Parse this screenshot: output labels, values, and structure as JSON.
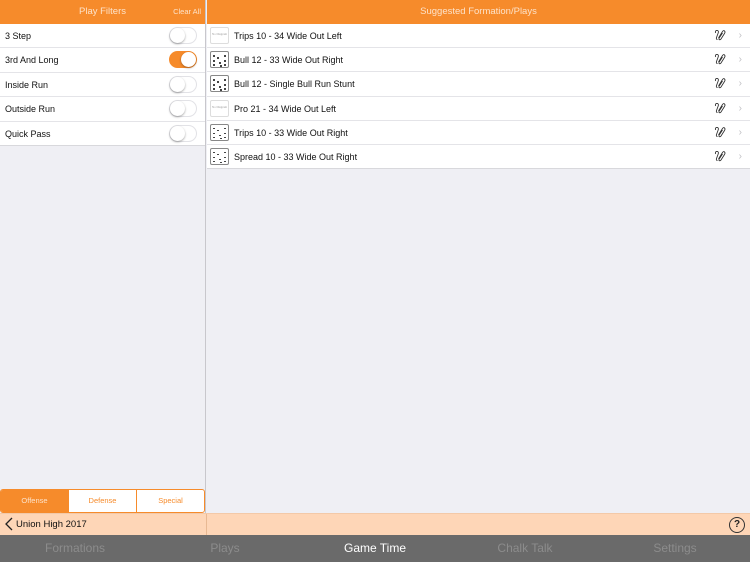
{
  "left_panel": {
    "title": "Play Filters",
    "clear_all": "Clear All",
    "filters": [
      {
        "label": "3 Step",
        "on": false
      },
      {
        "label": "3rd And Long",
        "on": true
      },
      {
        "label": "Inside Run",
        "on": false
      },
      {
        "label": "Outside Run",
        "on": false
      },
      {
        "label": "Quick Pass",
        "on": false
      }
    ],
    "segments": [
      {
        "label": "Offense",
        "active": true
      },
      {
        "label": "Defense",
        "active": false
      },
      {
        "label": "Special",
        "active": false
      }
    ]
  },
  "right_panel": {
    "title": "Suggested Formation/Plays",
    "plays": [
      {
        "name": "Trips 10 - 34 Wide Out Left",
        "thumb": "no-diagram",
        "thumb_text": "No Diagram"
      },
      {
        "name": "Bull 12 - 33 Wide Out Right",
        "thumb": "diagram"
      },
      {
        "name": "Bull 12 - Single Bull Run Stunt",
        "thumb": "diagram"
      },
      {
        "name": "Pro 21 - 34 Wide Out Left",
        "thumb": "no-diagram",
        "thumb_text": "No Diagram"
      },
      {
        "name": "Trips 10 - 33 Wide Out Right",
        "thumb": "diagram"
      },
      {
        "name": "Spread 10 - 33 Wide Out Right",
        "thumb": "diagram"
      }
    ]
  },
  "bottom_bar": {
    "back_label": "Union High 2017",
    "help_glyph": "?"
  },
  "tab_bar": {
    "tabs": [
      {
        "label": "Formations",
        "active": false
      },
      {
        "label": "Plays",
        "active": false
      },
      {
        "label": "Game Time",
        "active": true
      },
      {
        "label": "Chalk Talk",
        "active": false
      },
      {
        "label": "Settings",
        "active": false
      }
    ]
  },
  "colors": {
    "accent": "#f68b2b",
    "bar": "#fed6b7",
    "tab_bar": "#6a6a6a"
  }
}
